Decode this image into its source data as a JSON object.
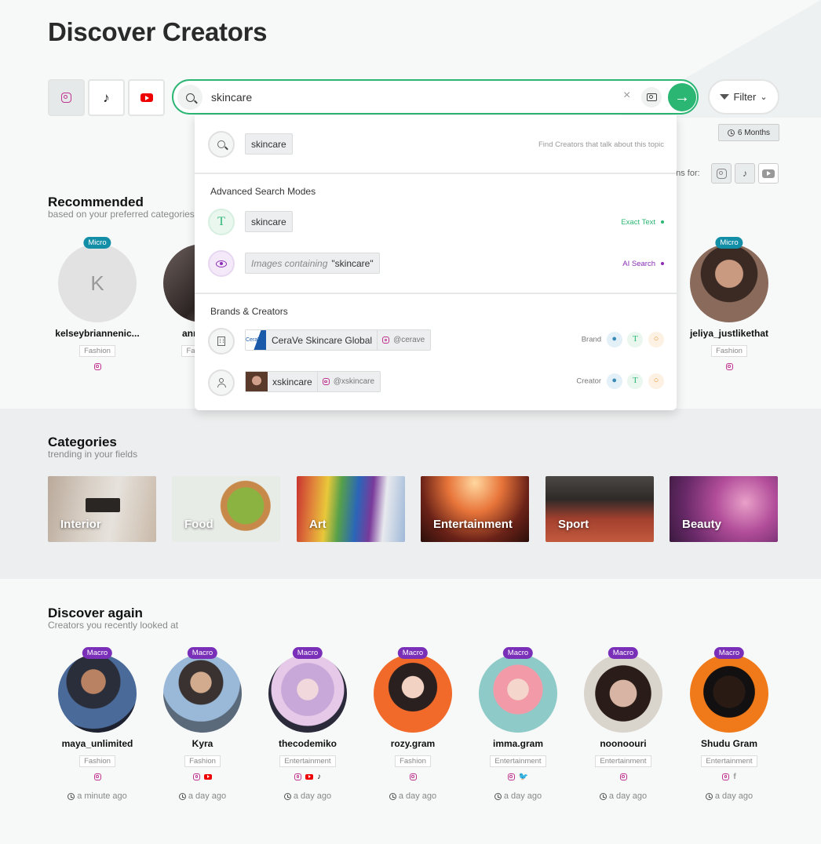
{
  "page": {
    "title": "Discover Creators"
  },
  "search": {
    "value": "skincare",
    "clear": "×",
    "go": "→"
  },
  "filter": {
    "label": "Filter",
    "chevron": "⌄"
  },
  "time_filter": {
    "label": "6 Months"
  },
  "suggestions_for": {
    "label": "ons for:"
  },
  "dropdown": {
    "topic": {
      "chip": "skincare",
      "hint": "Find Creators that talk about this topic"
    },
    "advanced_header": "Advanced Search Modes",
    "exact": {
      "icon_letter": "T",
      "chip": "skincare",
      "tag": "Exact Text"
    },
    "images": {
      "chip_prefix": "Images containing",
      "chip_query": "\"skincare\"",
      "tag": "AI Search"
    },
    "brands_header": "Brands & Creators",
    "brand": {
      "logo_text": "CeraVe",
      "name": "CeraVe Skincare Global",
      "handle": "@cerave",
      "type": "Brand"
    },
    "creator": {
      "name": "xskincare",
      "handle": "@xskincare",
      "type": "Creator"
    },
    "mini_t": "T"
  },
  "recommended": {
    "title": "Recommended",
    "subtitle": "based on your preferred categories",
    "creators": [
      {
        "name": "kelseybriannenic...",
        "badge": "Micro",
        "category": "Fashion",
        "initial": "K"
      },
      {
        "name": "anr",
        "badge": "",
        "category": "Fa"
      },
      {
        "name": "jeliya_justlikethat",
        "badge": "Micro",
        "category": "Fashion"
      }
    ]
  },
  "categories": {
    "title": "Categories",
    "subtitle": "trending in your fields",
    "items": [
      "Interior",
      "Food",
      "Art",
      "Entertainment",
      "Sport",
      "Beauty"
    ]
  },
  "discover_again": {
    "title": "Discover again",
    "subtitle": "Creators you recently looked at",
    "creators": [
      {
        "name": "maya_unlimited",
        "badge": "Macro",
        "category": "Fashion",
        "time": "a minute ago"
      },
      {
        "name": "Kyra",
        "badge": "Macro",
        "category": "Fashion",
        "time": "a day ago"
      },
      {
        "name": "thecodemiko",
        "badge": "Macro",
        "category": "Entertainment",
        "time": "a day ago"
      },
      {
        "name": "rozy.gram",
        "badge": "Macro",
        "category": "Fashion",
        "time": "a day ago"
      },
      {
        "name": "imma.gram",
        "badge": "Macro",
        "category": "Entertainment",
        "time": "a day ago"
      },
      {
        "name": "noonoouri",
        "badge": "Macro",
        "category": "Entertainment",
        "time": "a day ago"
      },
      {
        "name": "Shudu Gram",
        "badge": "Macro",
        "category": "Entertainment",
        "time": "a day ago"
      }
    ]
  },
  "colors": {
    "accent": "#2bb673",
    "micro": "#138ea7",
    "macro": "#7a2fb8",
    "ai": "#8a2cb5"
  },
  "icons": {
    "tiktok": "♪",
    "twitter": "🐦",
    "facebook": "f"
  }
}
